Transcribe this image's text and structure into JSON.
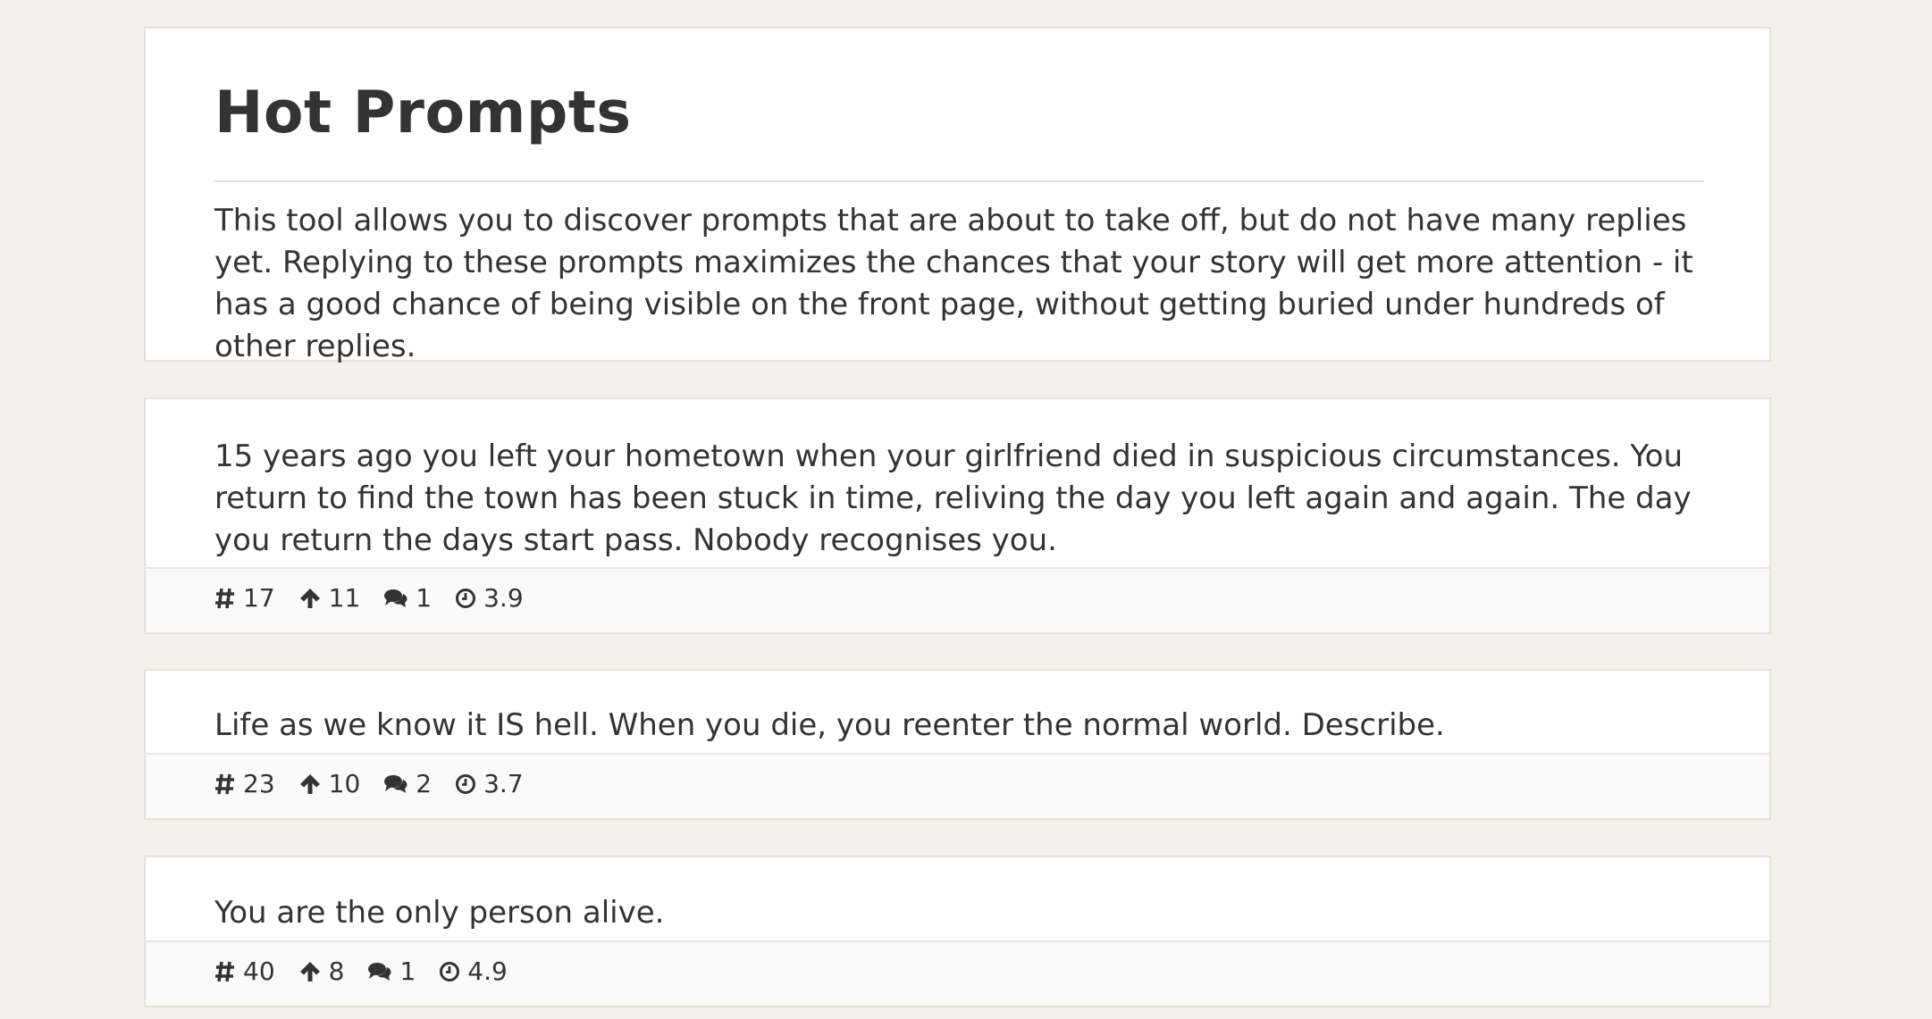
{
  "header": {
    "title": "Hot Prompts",
    "description": "This tool allows you to discover prompts that are about to take off, but do not have many replies yet. Replying to these prompts maximizes the chances that your story will get more attention - it has a good chance of being visible on the front page, without getting buried under hundreds of other replies."
  },
  "prompts": [
    {
      "text": "15 years ago you left your hometown when your girlfriend died in suspicious circumstances. You return to find the town has been stuck in time, reliving the day you left again and again. The day you return the days start pass. Nobody recognises you.",
      "rank": "17",
      "upvotes": "11",
      "comments": "1",
      "age": "3.9"
    },
    {
      "text": "Life as we know it IS hell. When you die, you reenter the normal world. Describe.",
      "rank": "23",
      "upvotes": "10",
      "comments": "2",
      "age": "3.7"
    },
    {
      "text": "You are the only person alive.",
      "rank": "40",
      "upvotes": "8",
      "comments": "1",
      "age": "4.9"
    }
  ],
  "icons": {
    "rank": "hashtag-icon",
    "upvotes": "arrow-up-icon",
    "comments": "comments-icon",
    "age": "clock-icon"
  },
  "colors": {
    "background": "#f3f1ea",
    "card": "#ffffff",
    "text": "#333333",
    "footer": "#fafafa"
  }
}
